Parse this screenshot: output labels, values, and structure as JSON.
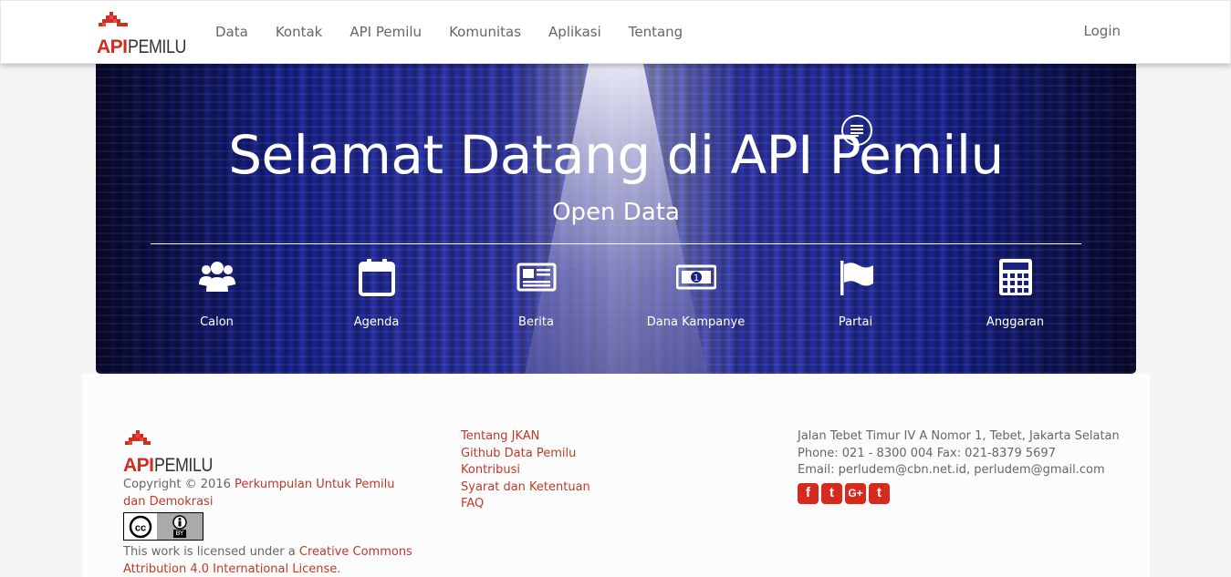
{
  "brand": {
    "api": "API",
    "pemilu": "PEMILU"
  },
  "nav": {
    "items": [
      {
        "label": "Data"
      },
      {
        "label": "Kontak"
      },
      {
        "label": "API Pemilu"
      },
      {
        "label": "Komunitas"
      },
      {
        "label": "Aplikasi"
      },
      {
        "label": "Tentang"
      }
    ],
    "login": "Login"
  },
  "hero": {
    "title": "Selamat Datang di API Pemilu",
    "subtitle": "Open Data",
    "categories": [
      {
        "label": "Calon",
        "icon": "users-icon"
      },
      {
        "label": "Agenda",
        "icon": "calendar-icon"
      },
      {
        "label": "Berita",
        "icon": "newspaper-icon"
      },
      {
        "label": "Dana Kampanye",
        "icon": "money-icon"
      },
      {
        "label": "Partai",
        "icon": "flag-icon"
      },
      {
        "label": "Anggaran",
        "icon": "calculator-icon"
      }
    ]
  },
  "footer": {
    "copyright_prefix": "Copyright © 2016 ",
    "copyright_org": "Perkumpulan Untuk Pemilu dan Demokrasi",
    "license_prefix": "This work is licensed under a ",
    "license_link": "Creative Commons Attribution 4.0 International License",
    "license_suffix": ".",
    "links": [
      {
        "label": "Tentang JKAN"
      },
      {
        "label": "Github Data Pemilu"
      },
      {
        "label": "Kontribusi"
      },
      {
        "label": "Syarat dan Ketentuan"
      },
      {
        "label": "FAQ"
      }
    ],
    "address": "Jalan Tebet Timur IV A Nomor 1, Tebet, Jakarta Selatan",
    "phone": "Phone: 021 - 8300 004 Fax: 021-8379 5697",
    "email": "Email: perludem@cbn.net.id, perludem@gmail.com",
    "socials": [
      {
        "glyph": "f",
        "icon": "facebook-icon"
      },
      {
        "glyph": "t",
        "icon": "twitter-icon"
      },
      {
        "glyph": "G+",
        "icon": "google-plus-icon"
      },
      {
        "glyph": "t",
        "icon": "tumblr-icon"
      }
    ],
    "cc_badge": {
      "by": "BY"
    }
  },
  "colors": {
    "accent": "#d52b1e",
    "link": "#c0392b"
  }
}
